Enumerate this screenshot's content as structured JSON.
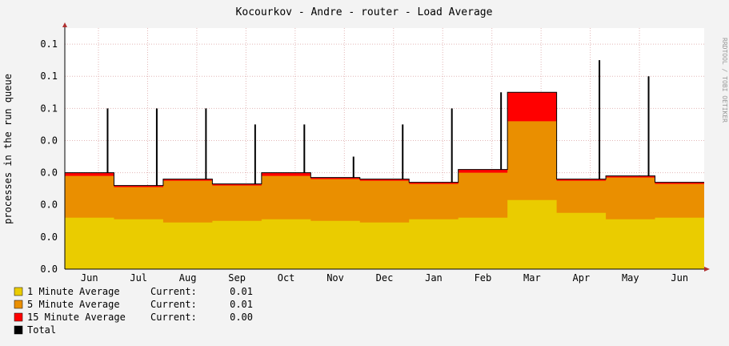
{
  "chart_data": {
    "type": "area",
    "title": "Kocourkov - Andre - router - Load Average",
    "ylabel": "processes in the run queue",
    "watermark": "RRDTOOL / TOBI OETIKER",
    "y_tick_labels": [
      "0.0",
      "0.0",
      "0.0",
      "0.0",
      "0.0",
      "0.1",
      "0.1",
      "0.1"
    ],
    "ylim": [
      0,
      0.15
    ],
    "grid": true,
    "categories": [
      "Jun",
      "Jul",
      "Aug",
      "Sep",
      "Oct",
      "Nov",
      "Dec",
      "Jan",
      "Feb",
      "Mar",
      "Apr",
      "May",
      "Jun"
    ],
    "spikes": [
      0.1,
      0.1,
      0.1,
      0.09,
      0.09,
      0.07,
      0.09,
      0.1,
      0.11,
      0.11,
      0.13,
      0.12
    ],
    "series": [
      {
        "name": "1 Minute Average",
        "color": "#eacc00",
        "current": "0.01",
        "values": [
          0.032,
          0.031,
          0.029,
          0.03,
          0.031,
          0.03,
          0.029,
          0.031,
          0.032,
          0.043,
          0.035,
          0.031,
          0.032
        ]
      },
      {
        "name": "5 Minute Average",
        "color": "#ea8f00",
        "current": "0.01",
        "values": [
          0.058,
          0.051,
          0.055,
          0.052,
          0.058,
          0.056,
          0.055,
          0.053,
          0.06,
          0.092,
          0.055,
          0.057,
          0.053
        ]
      },
      {
        "name": "15 Minute Average",
        "color": "#ff0000",
        "current": "0.00",
        "values": [
          0.06,
          0.052,
          0.056,
          0.053,
          0.06,
          0.057,
          0.056,
          0.054,
          0.062,
          0.11,
          0.056,
          0.058,
          0.054
        ]
      },
      {
        "name": "Total",
        "color": "#000000",
        "current": "",
        "values": [
          0.06,
          0.052,
          0.056,
          0.053,
          0.06,
          0.057,
          0.056,
          0.054,
          0.062,
          0.11,
          0.056,
          0.058,
          0.054
        ]
      }
    ]
  },
  "legend": {
    "current_label": "Current:"
  }
}
